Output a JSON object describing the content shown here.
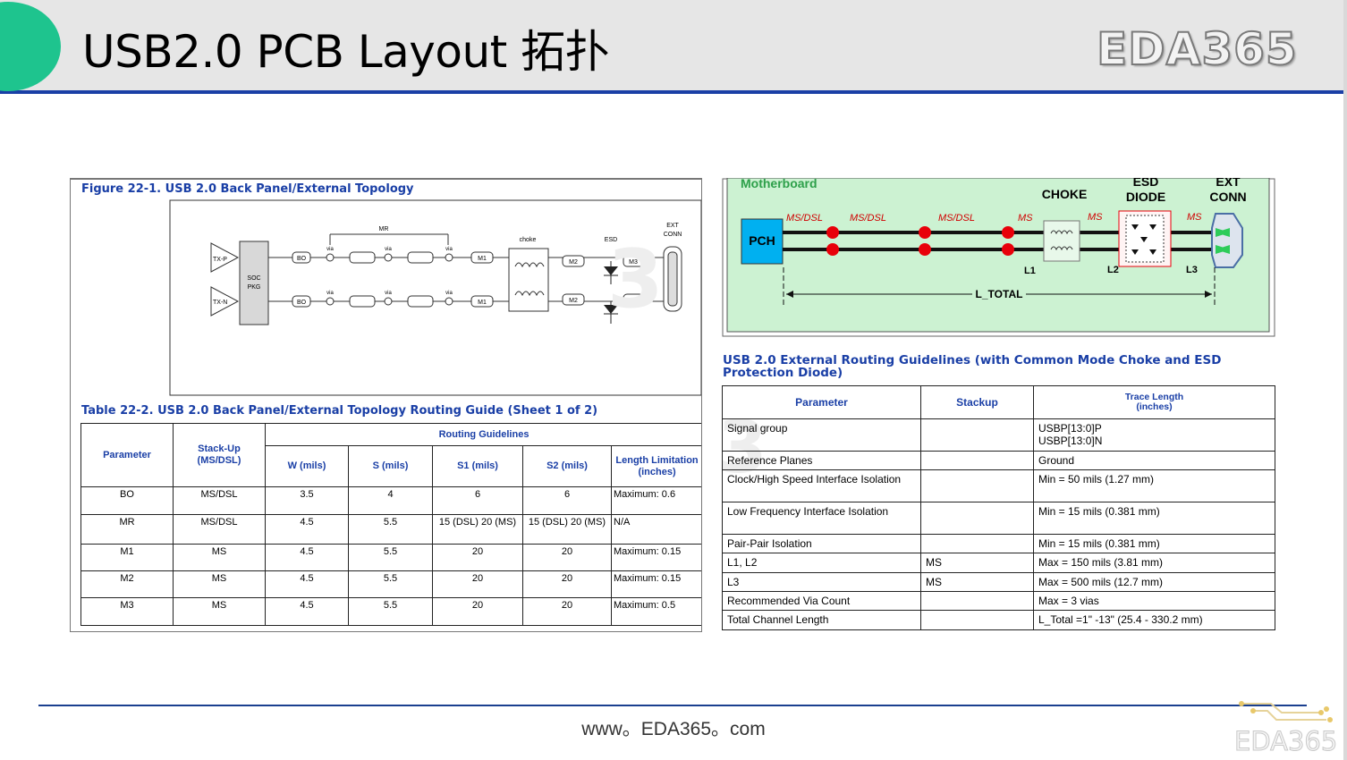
{
  "slide": {
    "title": "USB2.0 PCB Layout 拓扑",
    "logo": "EDA365",
    "footer": "www。EDA365。com",
    "footer_logo": "EDA365"
  },
  "colors": {
    "accent_green": "#1ec48e",
    "accent_blue": "#1a3fa6",
    "header_bg": "#e6e6e6",
    "diagram_green": "#ccf2d2",
    "pch_blue": "#00b0f0",
    "signal_red": "#e8000a"
  },
  "left_panel": {
    "figure_title": "Figure 22-1. USB 2.0 Back Panel/External Topology",
    "figure_labels": {
      "mr": "MR",
      "via": "via",
      "choke": "choke",
      "esd": "ESD",
      "ext": "EXT",
      "conn": "CONN",
      "txp": "TX-P",
      "txn": "TX-N",
      "soc": "SOC",
      "pkg": "PKG",
      "bo": "BO",
      "m1": "M1",
      "m2": "M2",
      "m3": "M3"
    },
    "table_title": "Table 22-2.  USB 2.0 Back Panel/External Topology Routing Guide (Sheet 1 of 2)",
    "table_header": {
      "parameter": "Parameter",
      "stackup": "Stack-Up (MS/DSL)",
      "routing": "Routing Guidelines",
      "w": "W (mils)",
      "s": "S (mils)",
      "s1": "S1 (mils)",
      "s2": "S2 (mils)",
      "length": "Length Limitation (inches)"
    },
    "rows": [
      {
        "param": "BO",
        "stack": "MS/DSL",
        "w": "3.5",
        "s": "4",
        "s1": "6",
        "s2": "6",
        "len": "Maximum: 0.6"
      },
      {
        "param": "MR",
        "stack": "MS/DSL",
        "w": "4.5",
        "s": "5.5",
        "s1": "15 (DSL) 20 (MS)",
        "s2": "15 (DSL) 20 (MS)",
        "len": "N/A"
      },
      {
        "param": "M1",
        "stack": "MS",
        "w": "4.5",
        "s": "5.5",
        "s1": "20",
        "s2": "20",
        "len": "Maximum: 0.15"
      },
      {
        "param": "M2",
        "stack": "MS",
        "w": "4.5",
        "s": "5.5",
        "s1": "20",
        "s2": "20",
        "len": "Maximum: 0.15"
      },
      {
        "param": "M3",
        "stack": "MS",
        "w": "4.5",
        "s": "5.5",
        "s1": "20",
        "s2": "20",
        "len": "Maximum: 0.5"
      }
    ]
  },
  "right_panel": {
    "diagram": {
      "motherboard": "Motherboard",
      "choke": "CHOKE",
      "esd1": "ESD",
      "esd2": "DIODE",
      "ext1": "EXT",
      "ext2": "CONN",
      "pch": "PCH",
      "segs": [
        "MS/DSL",
        "MS/DSL",
        "MS/DSL",
        "MS",
        "MS",
        "MS"
      ],
      "l1": "L1",
      "l2": "L2",
      "l3": "L3",
      "ltotal": "L_TOTAL"
    },
    "table_title": "USB 2.0 External Routing Guidelines (with Common Mode Choke and ESD Protection Diode)",
    "table_header": {
      "parameter": "Parameter",
      "stackup": "Stackup",
      "trace1": "Trace Length",
      "trace2": "(inches)"
    },
    "rows": [
      {
        "param": "Signal group",
        "stack": "",
        "value": "USBP[13:0]P USBP[13:0]N"
      },
      {
        "param": "Reference Planes",
        "stack": "",
        "value": "Ground"
      },
      {
        "param": "Clock/High Speed Interface Isolation",
        "stack": "",
        "value": "Min = 50 mils (1.27 mm)"
      },
      {
        "param": "Low Frequency Interface Isolation",
        "stack": "",
        "value": "Min = 15 mils (0.381 mm)"
      },
      {
        "param": "Pair-Pair Isolation",
        "stack": "",
        "value": "Min = 15 mils (0.381 mm)"
      },
      {
        "param": "L1, L2",
        "stack": "MS",
        "value": "Max = 150 mils (3.81 mm)"
      },
      {
        "param": "L3",
        "stack": "MS",
        "value": "Max = 500 mils (12.7 mm)"
      },
      {
        "param": "Recommended Via Count",
        "stack": "",
        "value": "Max = 3 vias"
      },
      {
        "param": "Total Channel Length",
        "stack": "",
        "value": "L_Total =1\" -13\" (25.4 - 330.2 mm)"
      }
    ]
  }
}
